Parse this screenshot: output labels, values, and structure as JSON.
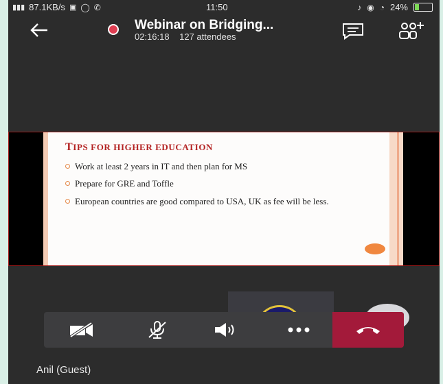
{
  "status_bar": {
    "network_speed": "87.1KB/s",
    "time": "11:50",
    "battery_percent": "24%",
    "battery_level": 0.24
  },
  "header": {
    "title": "Webinar on Bridging...",
    "duration": "02:16:18",
    "attendees": "127 attendees"
  },
  "slide": {
    "title_first": "T",
    "title_rest": "IPS FOR HIGHER EDUCATION",
    "bullets": [
      "Work at least 2 years in IT and then plan for MS",
      "Prepare for GRE and Toffle",
      "European countries are good compared to USA, UK as fee will be less."
    ]
  },
  "call_controls": {
    "icons": [
      "video-off-icon",
      "mic-off-icon",
      "speaker-icon",
      "more-icon",
      "hang-up-icon"
    ]
  },
  "participant": {
    "name": "Anil (Guest)"
  },
  "colors": {
    "background": "#2c2c2c",
    "recording": "#e03e52",
    "hangup": "#a31a3a",
    "slide_title": "#b32222"
  }
}
